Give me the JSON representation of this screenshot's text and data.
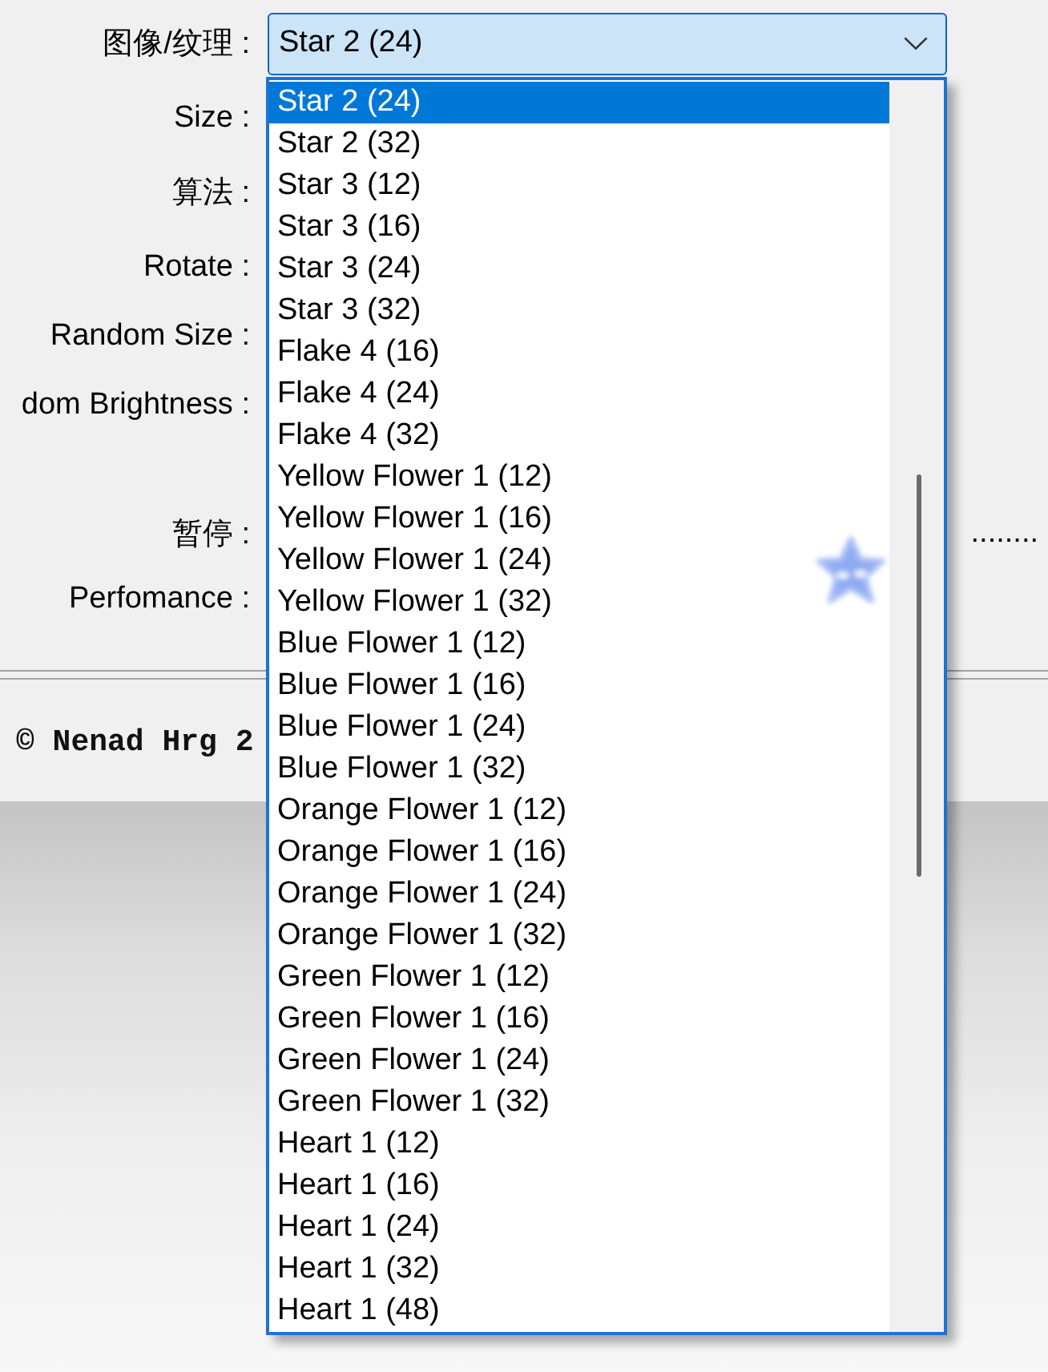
{
  "dialog": {
    "rows": [
      {
        "kind": "combo",
        "label": "图像/纹理 :"
      },
      {
        "kind": "plain",
        "label": "Size :"
      },
      {
        "kind": "plain",
        "label": "算法 :"
      },
      {
        "kind": "plain",
        "label": "Rotate :"
      },
      {
        "kind": "plain",
        "label": "Random Size :"
      },
      {
        "kind": "plain",
        "label": "dom Brightness :"
      },
      {
        "kind": "trailing",
        "label": "暂停 :",
        "trailing_text": "........"
      },
      {
        "kind": "plain",
        "label": "Perfomance :"
      }
    ],
    "copyright": "© Nenad Hrg 2"
  },
  "texture_combo": {
    "value": "Star 2 (24)",
    "expanded": true,
    "options": [
      {
        "label": "Star 2 (24)",
        "selected": true
      },
      {
        "label": "Star 2 (32)",
        "selected": false
      },
      {
        "label": "Star 3 (12)",
        "selected": false
      },
      {
        "label": "Star 3 (16)",
        "selected": false
      },
      {
        "label": "Star 3 (24)",
        "selected": false
      },
      {
        "label": "Star 3 (32)",
        "selected": false
      },
      {
        "label": "Flake 4 (16)",
        "selected": false
      },
      {
        "label": "Flake 4 (24)",
        "selected": false
      },
      {
        "label": "Flake 4 (32)",
        "selected": false
      },
      {
        "label": "Yellow Flower 1 (12)",
        "selected": false
      },
      {
        "label": "Yellow Flower 1 (16)",
        "selected": false
      },
      {
        "label": "Yellow Flower 1 (24)",
        "selected": false
      },
      {
        "label": "Yellow Flower 1 (32)",
        "selected": false
      },
      {
        "label": "Blue Flower 1 (12)",
        "selected": false
      },
      {
        "label": "Blue Flower 1 (16)",
        "selected": false
      },
      {
        "label": "Blue Flower 1 (24)",
        "selected": false
      },
      {
        "label": "Blue Flower 1 (32)",
        "selected": false
      },
      {
        "label": "Orange Flower 1 (12)",
        "selected": false
      },
      {
        "label": "Orange Flower 1 (16)",
        "selected": false
      },
      {
        "label": "Orange Flower 1 (24)",
        "selected": false
      },
      {
        "label": "Orange Flower 1 (32)",
        "selected": false
      },
      {
        "label": "Green Flower 1 (12)",
        "selected": false
      },
      {
        "label": "Green Flower 1 (16)",
        "selected": false
      },
      {
        "label": "Green Flower 1 (24)",
        "selected": false
      },
      {
        "label": "Green Flower 1 (32)",
        "selected": false
      },
      {
        "label": "Heart 1 (12)",
        "selected": false
      },
      {
        "label": "Heart 1 (16)",
        "selected": false
      },
      {
        "label": "Heart 1 (24)",
        "selected": false
      },
      {
        "label": "Heart 1 (32)",
        "selected": false
      },
      {
        "label": "Heart 1 (48)",
        "selected": false
      }
    ]
  }
}
